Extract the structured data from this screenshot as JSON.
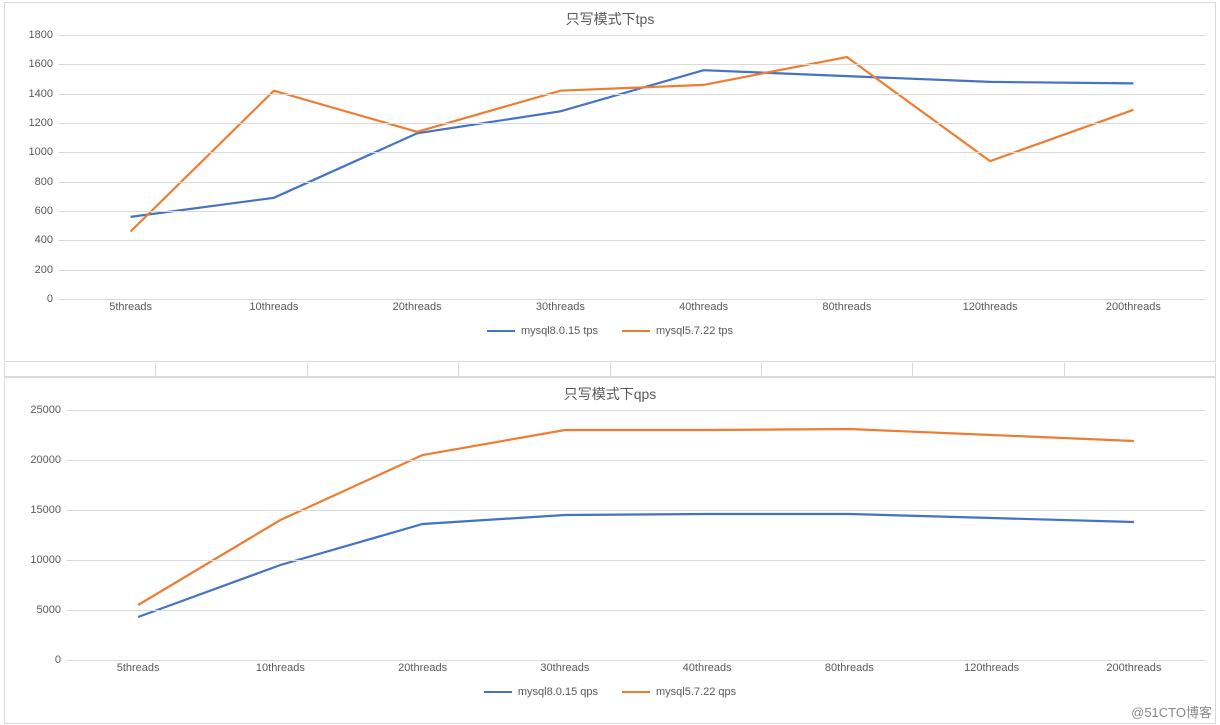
{
  "watermark": "@51CTO博客",
  "chart_data": [
    {
      "type": "line",
      "title": "只写模式下tps",
      "categories": [
        "5threads",
        "10threads",
        "20threads",
        "30threads",
        "40threads",
        "80threads",
        "120threads",
        "200threads"
      ],
      "series": [
        {
          "name": "mysql8.0.15 tps",
          "color": "#4472C4",
          "values": [
            560,
            690,
            1130,
            1280,
            1560,
            1520,
            1480,
            1470
          ]
        },
        {
          "name": "mysql5.7.22 tps",
          "color": "#ED7D31",
          "values": [
            460,
            1420,
            1140,
            1420,
            1460,
            1650,
            940,
            1290
          ]
        }
      ],
      "ylim": [
        0,
        1800
      ],
      "ystep": 200,
      "xlabel": "",
      "ylabel": ""
    },
    {
      "type": "line",
      "title": "只写模式下qps",
      "categories": [
        "5threads",
        "10threads",
        "20threads",
        "30threads",
        "40threads",
        "80threads",
        "120threads",
        "200threads"
      ],
      "series": [
        {
          "name": "mysql8.0.15 qps",
          "color": "#4472C4",
          "values": [
            4300,
            9500,
            13600,
            14500,
            14600,
            14600,
            14200,
            13800
          ]
        },
        {
          "name": "mysql5.7.22 qps",
          "color": "#ED7D31",
          "values": [
            5500,
            14000,
            20500,
            23000,
            23000,
            23100,
            22500,
            21900
          ]
        }
      ],
      "ylim": [
        0,
        25000
      ],
      "ystep": 5000,
      "xlabel": "",
      "ylabel": ""
    }
  ]
}
